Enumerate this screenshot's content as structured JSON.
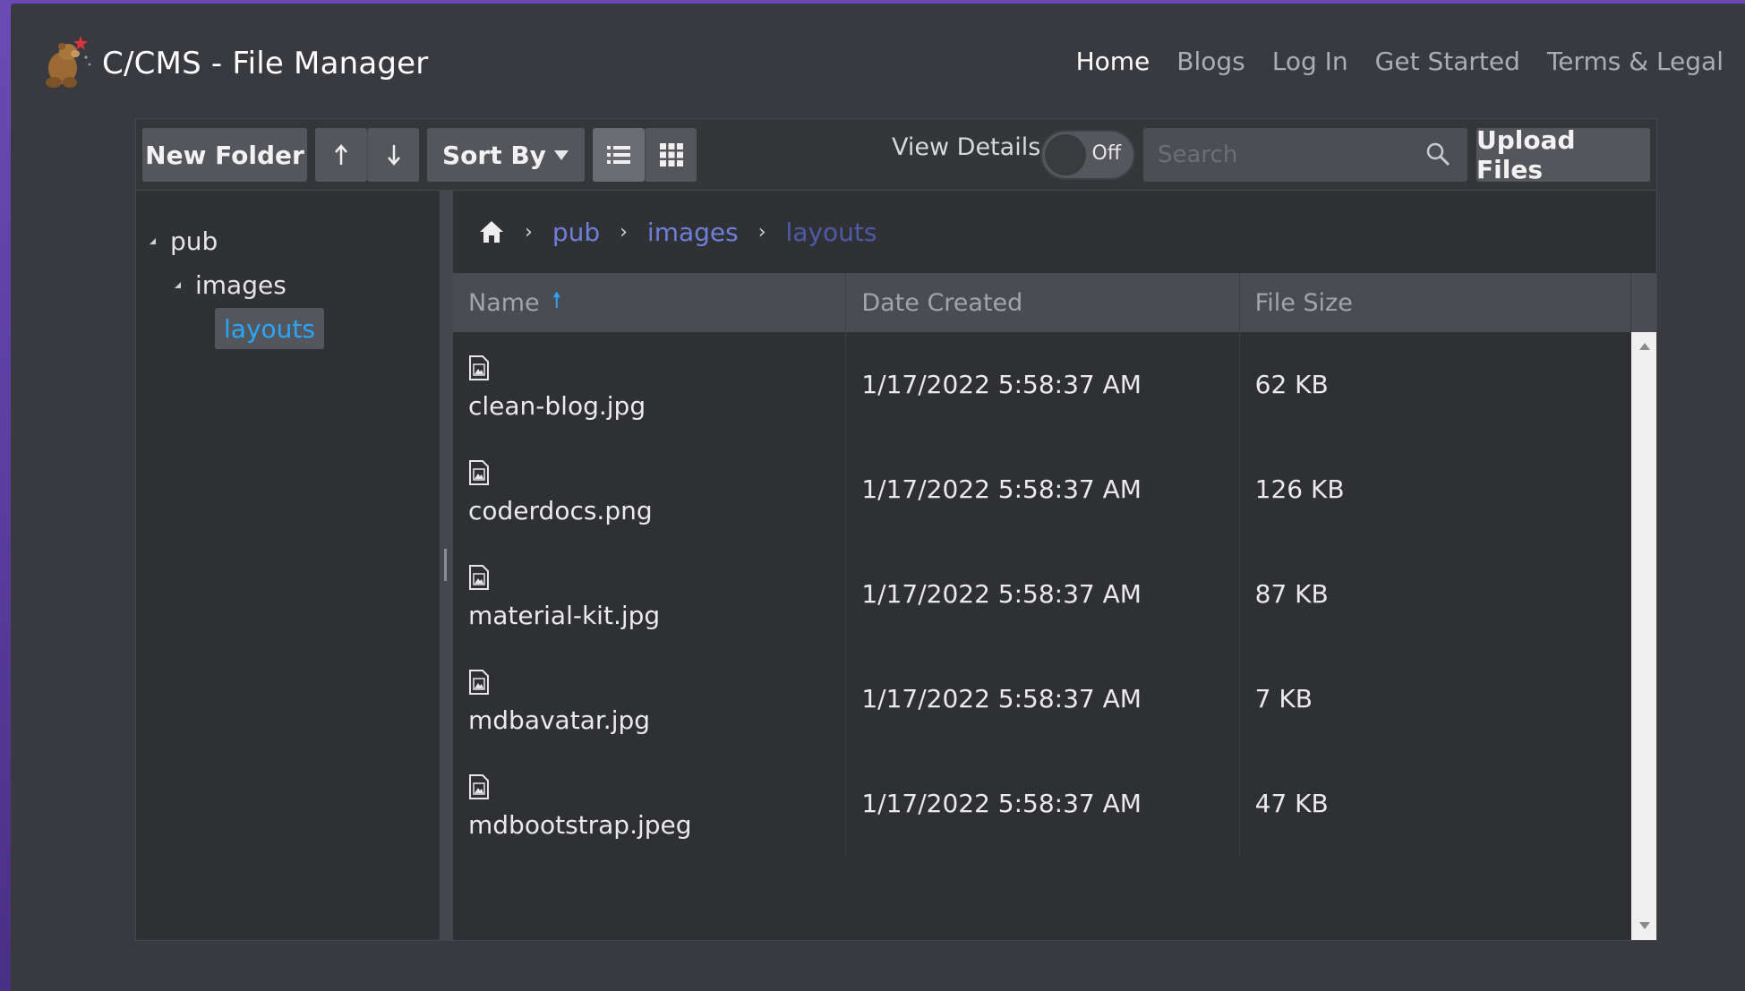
{
  "brand": {
    "title": "C/CMS - File Manager"
  },
  "nav": {
    "items": [
      {
        "label": "Home",
        "active": true
      },
      {
        "label": "Blogs"
      },
      {
        "label": "Log In"
      },
      {
        "label": "Get Started"
      },
      {
        "label": "Terms & Legal"
      }
    ]
  },
  "toolbar": {
    "new_folder": "New Folder",
    "sort_by": "Sort By",
    "view_details_label": "View Details",
    "view_details_state": "Off",
    "search_placeholder": "Search",
    "upload": "Upload Files"
  },
  "tree": {
    "nodes": [
      {
        "label": "pub"
      },
      {
        "label": "images"
      },
      {
        "label": "layouts",
        "selected": true
      }
    ]
  },
  "breadcrumb": [
    "pub",
    "images",
    "layouts"
  ],
  "grid": {
    "headers": {
      "name": "Name",
      "date": "Date Created",
      "size": "File Size"
    },
    "rows": [
      {
        "name": "clean-blog.jpg",
        "date": "1/17/2022 5:58:37 AM",
        "size": "62 KB"
      },
      {
        "name": "coderdocs.png",
        "date": "1/17/2022 5:58:37 AM",
        "size": "126 KB"
      },
      {
        "name": "material-kit.jpg",
        "date": "1/17/2022 5:58:37 AM",
        "size": "87 KB"
      },
      {
        "name": "mdbavatar.jpg",
        "date": "1/17/2022 5:58:37 AM",
        "size": "7 KB"
      },
      {
        "name": "mdbootstrap.jpeg",
        "date": "1/17/2022 5:58:37 AM",
        "size": "47 KB"
      }
    ]
  },
  "colors": {
    "accent": "#29a6ff",
    "crumb": "#6e7fd9",
    "background": "#383a40"
  }
}
